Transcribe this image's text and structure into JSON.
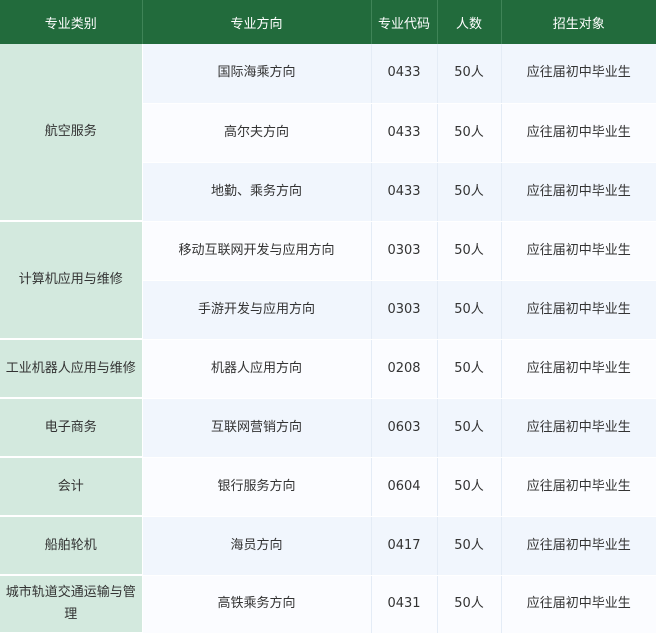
{
  "headers": {
    "category": "专业类别",
    "direction": "专业方向",
    "code": "专业代码",
    "count": "人数",
    "target": "招生对象"
  },
  "rows": [
    {
      "category": "航空服务",
      "direction": "国际海乘方向",
      "code": "0433",
      "count": "50人",
      "target": "应往届初中毕业生"
    },
    {
      "direction": "高尔夫方向",
      "code": "0433",
      "count": "50人",
      "target": "应往届初中毕业生"
    },
    {
      "direction": "地勤、乘务方向",
      "code": "0433",
      "count": "50人",
      "target": "应往届初中毕业生"
    },
    {
      "category": "计算机应用与维修",
      "direction": "移动互联网开发与应用方向",
      "code": "0303",
      "count": "50人",
      "target": "应往届初中毕业生"
    },
    {
      "direction": "手游开发与应用方向",
      "code": "0303",
      "count": "50人",
      "target": "应往届初中毕业生"
    },
    {
      "category": "工业机器人应用与维修",
      "direction": "机器人应用方向",
      "code": "0208",
      "count": "50人",
      "target": "应往届初中毕业生"
    },
    {
      "category": "电子商务",
      "direction": "互联网营销方向",
      "code": "0603",
      "count": "50人",
      "target": "应往届初中毕业生"
    },
    {
      "category": "会计",
      "direction": "银行服务方向",
      "code": "0604",
      "count": "50人",
      "target": "应往届初中毕业生"
    },
    {
      "category": "船舶轮机",
      "direction": "海员方向",
      "code": "0417",
      "count": "50人",
      "target": "应往届初中毕业生"
    },
    {
      "category": "城市轨道交通运输与管理",
      "direction": "高铁乘务方向",
      "code": "0431",
      "count": "50人",
      "target": "应往届初中毕业生"
    }
  ]
}
